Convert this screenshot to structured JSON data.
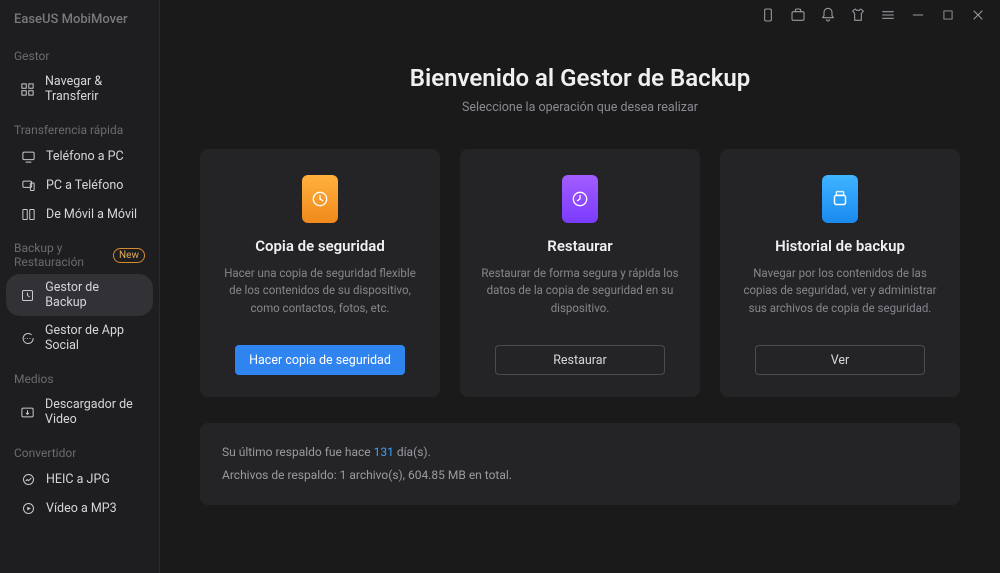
{
  "app_title": "EaseUS MobiMover",
  "sidebar": {
    "sections": [
      {
        "header": "Gestor",
        "badge": null,
        "items": [
          {
            "label": "Navegar & Transferir",
            "icon": "grid-icon",
            "active": false
          }
        ]
      },
      {
        "header": "Transferencia rápida",
        "badge": null,
        "items": [
          {
            "label": "Teléfono a PC",
            "icon": "phone-to-pc-icon",
            "active": false
          },
          {
            "label": "PC a Teléfono",
            "icon": "pc-to-phone-icon",
            "active": false
          },
          {
            "label": "De Móvil a Móvil",
            "icon": "phone-to-phone-icon",
            "active": false
          }
        ]
      },
      {
        "header": "Backup y Restauración",
        "badge": "New",
        "items": [
          {
            "label": "Gestor de Backup",
            "icon": "backup-manager-icon",
            "active": true
          },
          {
            "label": "Gestor de App Social",
            "icon": "chat-icon",
            "active": false
          }
        ]
      },
      {
        "header": "Medios",
        "badge": null,
        "items": [
          {
            "label": "Descargador de Video",
            "icon": "video-download-icon",
            "active": false
          }
        ]
      },
      {
        "header": "Convertidor",
        "badge": null,
        "items": [
          {
            "label": "HEIC a JPG",
            "icon": "heic-jpg-icon",
            "active": false
          },
          {
            "label": "Vídeo a MP3",
            "icon": "video-mp3-icon",
            "active": false
          }
        ]
      }
    ]
  },
  "main": {
    "title": "Bienvenido al Gestor de Backup",
    "subtitle": "Seleccione la operación que desea realizar",
    "cards": [
      {
        "title": "Copia de seguridad",
        "desc": "Hacer una copia de seguridad flexible de los contenidos de su dispositivo, como contactos, fotos, etc.",
        "button": "Hacer copia de seguridad",
        "style": "primary",
        "icon": "backup-icon",
        "color": "orange"
      },
      {
        "title": "Restaurar",
        "desc": "Restaurar de forma segura y rápida los datos de la copia de seguridad en su dispositivo.",
        "button": "Restaurar",
        "style": "outline",
        "icon": "restore-icon",
        "color": "purple"
      },
      {
        "title": "Historial de backup",
        "desc": "Navegar por los contenidos de las copias de seguridad, ver y administrar sus archivos de copia de seguridad.",
        "button": "Ver",
        "style": "outline",
        "icon": "history-icon",
        "color": "blue"
      }
    ],
    "footer": {
      "line1_a": "Su último respaldo fue hace ",
      "line1_accent": "131",
      "line1_b": " día(s).",
      "line2": "Archivos de respaldo: 1 archivo(s), 604.85 MB en total."
    }
  }
}
